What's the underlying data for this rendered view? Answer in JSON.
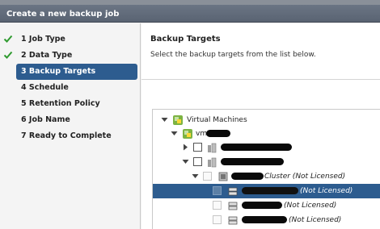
{
  "dialog": {
    "title": "Create a new backup job"
  },
  "wizard": {
    "steps": [
      {
        "label": "1  Job Type",
        "done": true
      },
      {
        "label": "2  Data Type",
        "done": true
      },
      {
        "label": "3  Backup Targets",
        "active": true
      },
      {
        "label": "4  Schedule"
      },
      {
        "label": "5  Retention Policy"
      },
      {
        "label": "6  Job Name"
      },
      {
        "label": "7  Ready to Complete"
      }
    ]
  },
  "content": {
    "title": "Backup Targets",
    "description": "Select the backup targets from the list below."
  },
  "tree": {
    "root_label": "Virtual Machines",
    "vm_prefix": "vm",
    "cluster_suffix": "Cluster (Not Licensed)",
    "not_licensed_1": "(Not Licensed)",
    "not_licensed_2": "(Not Licensed)",
    "not_licensed_3": "(Not Licensed)"
  },
  "colors": {
    "accent": "#2d5c8f",
    "title_bar": "#626c7b",
    "check_green": "#2f9a2f"
  },
  "icons": {
    "done_step": "checkmark-icon",
    "vm_folder": "vsphere-icon",
    "datacenter": "datacenter-icon",
    "cluster": "cluster-icon",
    "host": "host-icon"
  }
}
